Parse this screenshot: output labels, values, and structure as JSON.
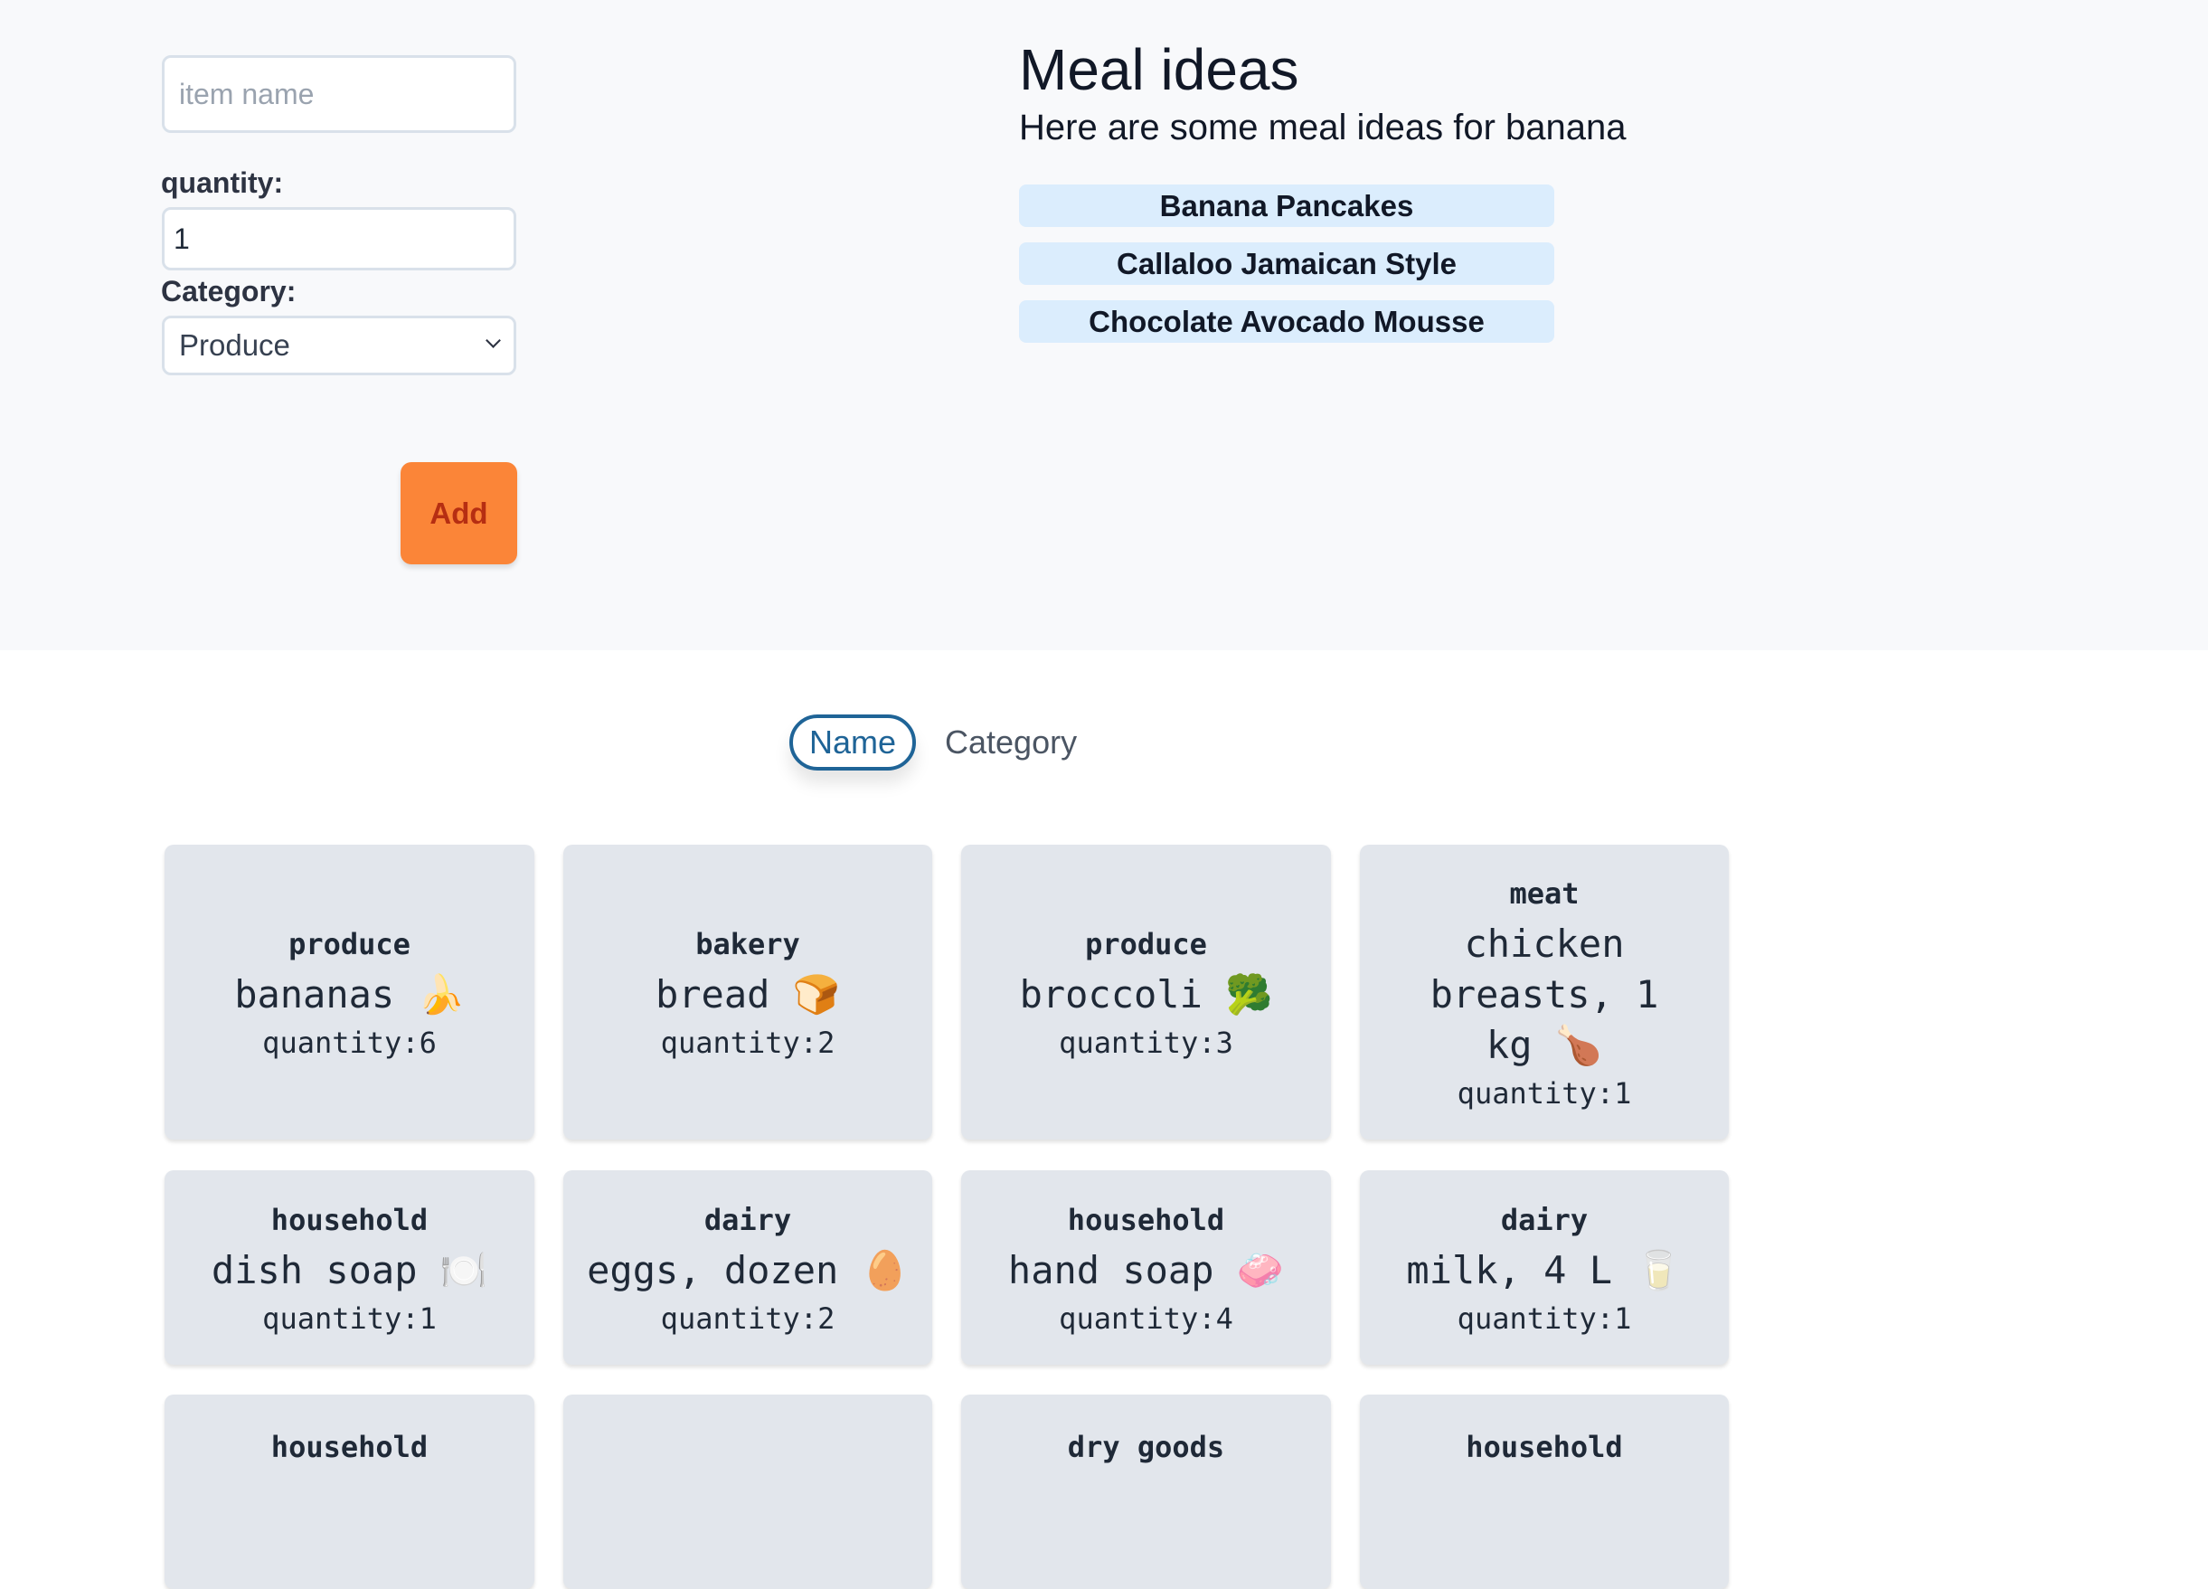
{
  "form": {
    "item_name_placeholder": "item name",
    "quantity_label": "quantity:",
    "quantity_value": "1",
    "category_label": "Category:",
    "category_selected": "Produce",
    "add_button_label": "Add"
  },
  "meals": {
    "title": "Meal ideas",
    "subtitle": "Here are some meal ideas for banana",
    "items": [
      "Banana Pancakes",
      "Callaloo Jamaican Style",
      "Chocolate Avocado Mousse"
    ]
  },
  "sort": {
    "tabs": [
      "Name",
      "Category"
    ],
    "active": "Name"
  },
  "items": [
    {
      "category": "produce",
      "name": "bananas 🍌",
      "quantity": "quantity:6"
    },
    {
      "category": "bakery",
      "name": "bread 🍞",
      "quantity": "quantity:2"
    },
    {
      "category": "produce",
      "name": "broccoli 🥦",
      "quantity": "quantity:3"
    },
    {
      "category": "meat",
      "name": "chicken breasts, 1 kg 🍗",
      "quantity": "quantity:1"
    },
    {
      "category": "household",
      "name": "dish soap 🍽️",
      "quantity": "quantity:1"
    },
    {
      "category": "dairy",
      "name": "eggs, dozen 🥚",
      "quantity": "quantity:2"
    },
    {
      "category": "household",
      "name": "hand soap 🧼",
      "quantity": "quantity:4"
    },
    {
      "category": "dairy",
      "name": "milk, 4 L 🥛",
      "quantity": "quantity:1"
    },
    {
      "category": "household",
      "name": "",
      "quantity": ""
    },
    {
      "category": "",
      "name": "",
      "quantity": ""
    },
    {
      "category": "dry goods",
      "name": "",
      "quantity": ""
    },
    {
      "category": "household",
      "name": "",
      "quantity": ""
    }
  ],
  "colors": {
    "accent": "#1f6497",
    "add_button": "#fb8538",
    "pill": "#dbedfd",
    "card": "#e2e6ec"
  }
}
